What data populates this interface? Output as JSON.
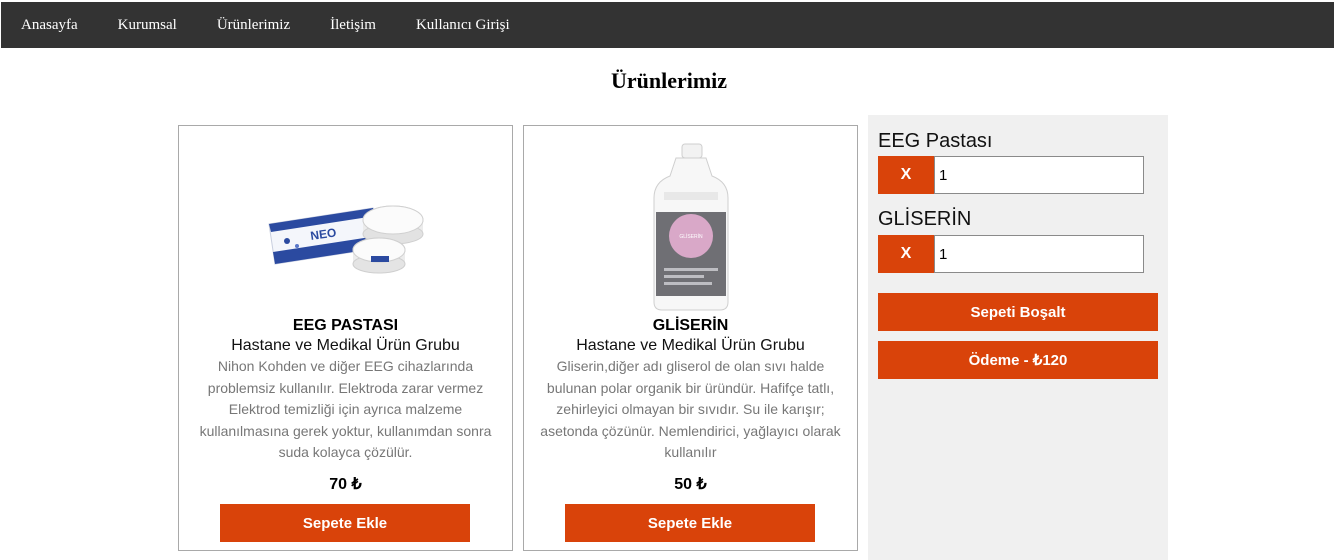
{
  "nav": {
    "items": [
      "Anasayfa",
      "Kurumsal",
      "Ürünlerimiz",
      "İletişim",
      "Kullanıcı Girişi"
    ]
  },
  "page": {
    "title": "Ürünlerimiz"
  },
  "products": [
    {
      "name": "EEG PASTASI",
      "category": "Hastane ve Medikal Ürün Grubu",
      "description": "Nihon Kohden ve diğer EEG cihazlarında problemsiz kullanılır. Elektroda zarar vermez Elektrod temizliği için ayrıca malzeme kullanılmasına gerek yoktur, kullanımdan sonra suda kolayca çözülür.",
      "price": "70 ₺",
      "add_label": "Sepete Ekle"
    },
    {
      "name": "GLİSERİN",
      "category": "Hastane ve Medikal Ürün Grubu",
      "description": "Gliserin,diğer adı gliserol de olan sıvı halde bulunan polar organik bir üründür. Hafifçe tatlı, zehirleyici olmayan bir sıvıdır. Su ile karışır; asetonda çözünür. Nemlendirici, yağlayıcı olarak kullanılır",
      "price": "50 ₺",
      "add_label": "Sepete Ekle"
    }
  ],
  "cart": {
    "items": [
      {
        "name": "EEG Pastası",
        "remove_label": "X",
        "qty": "1"
      },
      {
        "name": "GLİSERİN",
        "remove_label": "X",
        "qty": "1"
      }
    ],
    "empty_label": "Sepeti Boşalt",
    "checkout_label": "Ödeme - ₺120"
  },
  "colors": {
    "accent": "#d9430a",
    "nav_bg": "#333333",
    "cart_bg": "#f0f0f0"
  }
}
